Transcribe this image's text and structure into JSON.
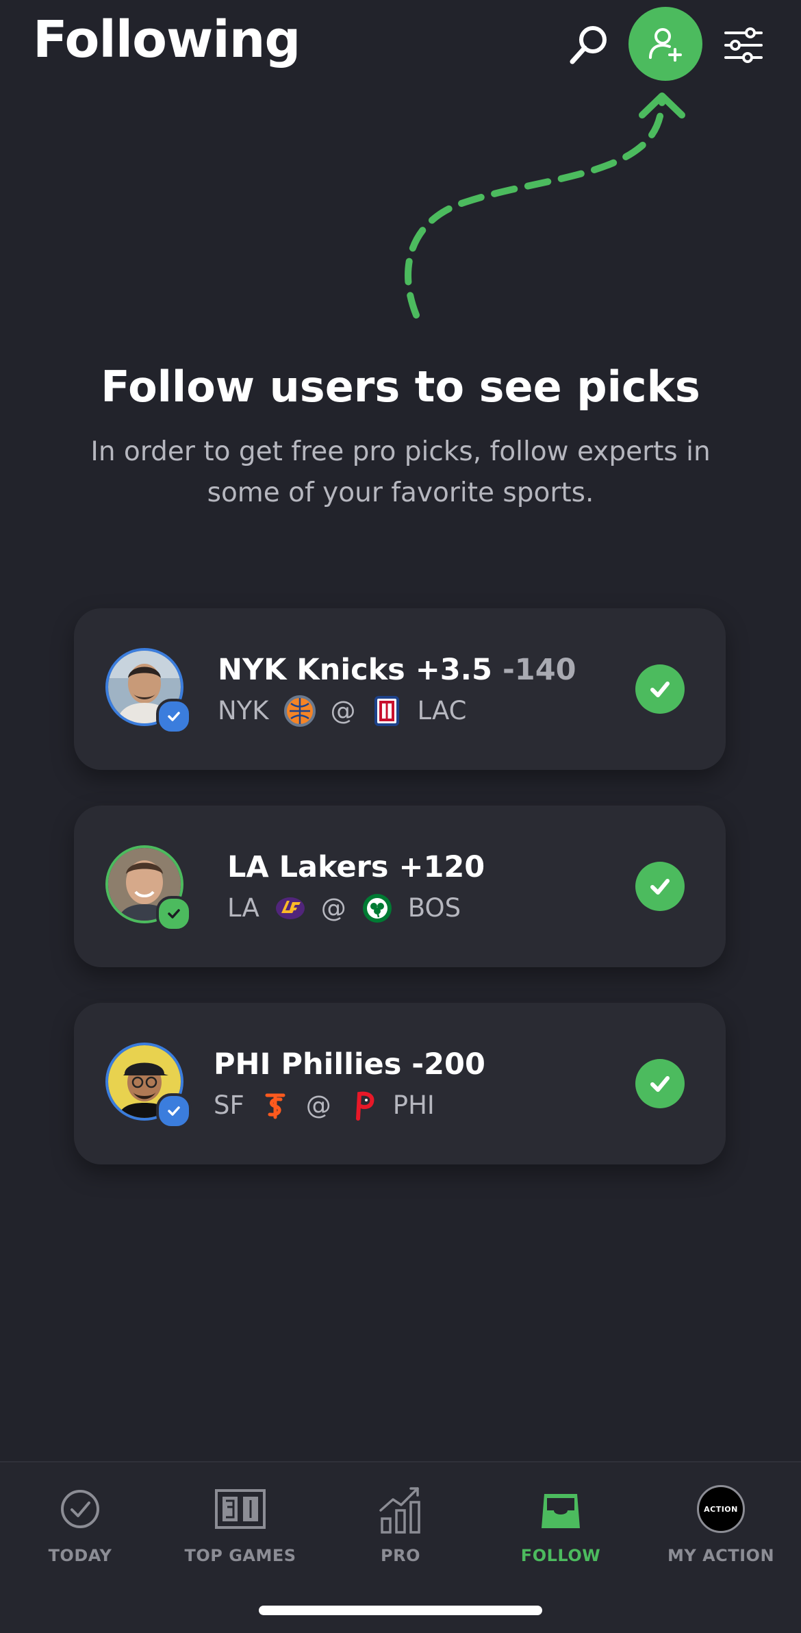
{
  "header": {
    "title": "Following"
  },
  "empty_state": {
    "headline": "Follow users to see picks",
    "subtext": "In order to get free pro picks, follow experts in some of your favorite sports."
  },
  "picks": [
    {
      "pick": "NYK Knicks +3.5",
      "odds": "-140",
      "away": "NYK",
      "at": "@",
      "home": "LAC",
      "avatar_ring": "#3b7ddd",
      "badge": "#3b7ddd"
    },
    {
      "pick": "LA Lakers +120",
      "odds": "",
      "away": "LA",
      "at": "@",
      "home": "BOS",
      "avatar_ring": "#4cbb5e",
      "badge": "#4cbb5e"
    },
    {
      "pick": "PHI Phillies -200",
      "odds": "",
      "away": "SF",
      "at": "@",
      "home": "PHI",
      "avatar_ring": "#3b7ddd",
      "badge": "#3b7ddd"
    }
  ],
  "tabs": [
    {
      "label": "TODAY",
      "icon": "check-circle-icon"
    },
    {
      "label": "TOP GAMES",
      "icon": "scoreboard-icon"
    },
    {
      "label": "PRO",
      "icon": "chart-icon"
    },
    {
      "label": "FOLLOW",
      "icon": "inbox-icon",
      "active": true
    },
    {
      "label": "MY ACTION",
      "icon": "action-logo-icon",
      "logo_text": "ACTION"
    }
  ],
  "colors": {
    "accent": "#4cbb5e",
    "background": "#22232b",
    "card": "#2a2b33",
    "verified_blue": "#3b7ddd"
  }
}
